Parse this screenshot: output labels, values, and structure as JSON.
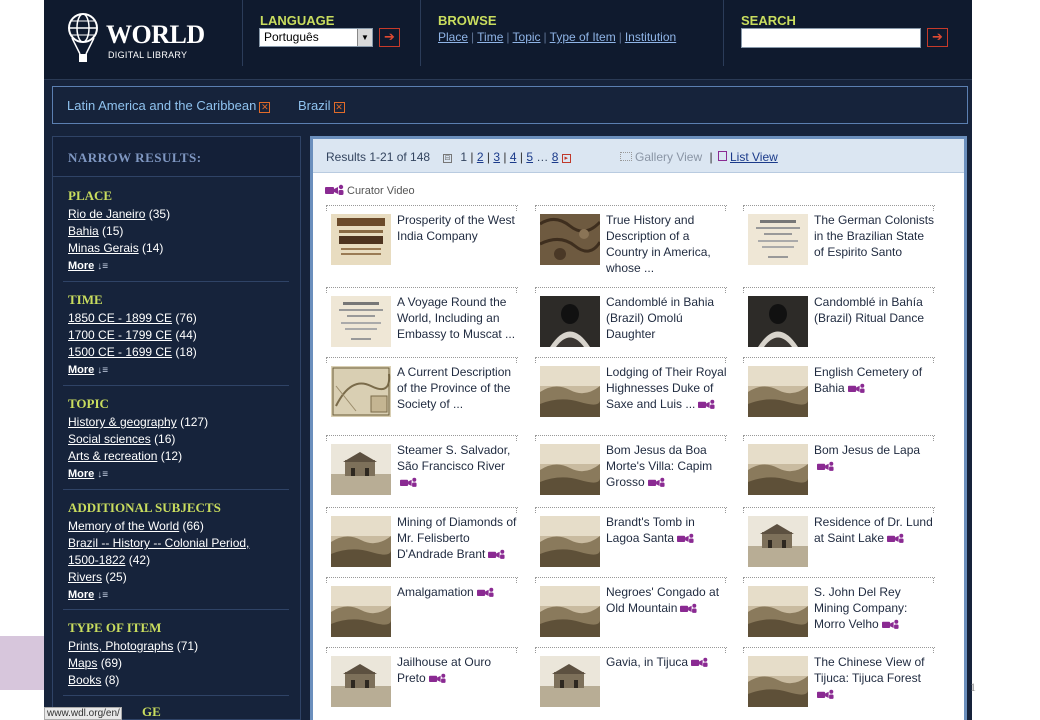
{
  "header": {
    "logo_word": "WORLD",
    "logo_sub": "DIGITAL LIBRARY",
    "language_label": "LANGUAGE",
    "language_value": "Português",
    "browse_label": "BROWSE",
    "browse_links": [
      "Place",
      "Time",
      "Topic",
      "Type of Item",
      "Institution"
    ],
    "search_label": "SEARCH",
    "go_glyph": "➔"
  },
  "filters": [
    "Latin America and the Caribbean",
    "Brazil"
  ],
  "filter_remove_glyph": "✕",
  "sidebar": {
    "heading": "NARROW RESULTS:",
    "more_label": "More",
    "sections": [
      {
        "title": "PLACE",
        "items": [
          {
            "label": "Rio de Janeiro",
            "count": "(35)"
          },
          {
            "label": "Bahia",
            "count": "(15)"
          },
          {
            "label": "Minas Gerais",
            "count": "(14)"
          }
        ]
      },
      {
        "title": "TIME",
        "items": [
          {
            "label": "1850 CE - 1899 CE",
            "count": "(76)"
          },
          {
            "label": "1700 CE - 1799 CE",
            "count": "(44)"
          },
          {
            "label": "1500 CE - 1699 CE",
            "count": "(18)"
          }
        ]
      },
      {
        "title": "TOPIC",
        "items": [
          {
            "label": "History & geography",
            "count": "(127)"
          },
          {
            "label": "Social sciences",
            "count": "(16)"
          },
          {
            "label": "Arts & recreation",
            "count": "(12)"
          }
        ]
      },
      {
        "title": "ADDITIONAL SUBJECTS",
        "items": [
          {
            "label": "Memory of the World",
            "count": "(66)"
          },
          {
            "label": "Brazil -- History -- Colonial Period,",
            "count": ""
          },
          {
            "label": "1500-1822",
            "count": "(42)"
          },
          {
            "label": "Rivers",
            "count": "(25)"
          }
        ]
      },
      {
        "title": "TYPE OF ITEM",
        "items": [
          {
            "label": "Prints, Photographs",
            "count": "(71)"
          },
          {
            "label": "Maps",
            "count": "(69)"
          },
          {
            "label": "Books",
            "count": "(8)"
          }
        ]
      }
    ],
    "cut_heading": "GE"
  },
  "results": {
    "summary": "Results 1-21 of 148",
    "pages": [
      "1",
      "2",
      "3",
      "4",
      "5",
      "…",
      "8"
    ],
    "gallery_view": "Gallery View",
    "list_view": "List View",
    "curator_video": "Curator Video",
    "items": [
      {
        "title": "Prosperity of the West India Company",
        "video": false,
        "thumb": "book"
      },
      {
        "title": "True History and Description of a Country in America, whose ...",
        "video": false,
        "thumb": "leather"
      },
      {
        "title": "The German Colonists in the Brazilian State of Espirito Santo",
        "video": false,
        "thumb": "page"
      },
      {
        "title": "A Voyage Round the World, Including an Embassy to Muscat ...",
        "video": false,
        "thumb": "page"
      },
      {
        "title": "Candomblé in Bahia (Brazil) Omolú Daughter",
        "video": false,
        "thumb": "dark"
      },
      {
        "title": "Candomblé in Bahía (Brazil) Ritual Dance",
        "video": false,
        "thumb": "dark"
      },
      {
        "title": "A Current Description of the Province of the Society of ...",
        "video": false,
        "thumb": "map"
      },
      {
        "title": "Lodging of Their Royal Highnesses Duke of Saxe and Luis ...",
        "video": true,
        "thumb": "sepia"
      },
      {
        "title": "English Cemetery of Bahia",
        "video": true,
        "thumb": "sepia"
      },
      {
        "title": "Steamer S. Salvador, São Francisco River",
        "video": true,
        "thumb": "light"
      },
      {
        "title": "Bom Jesus da Boa Morte's Villa: Capim Grosso",
        "video": true,
        "thumb": "sepia"
      },
      {
        "title": "Bom Jesus de Lapa",
        "video": true,
        "thumb": "sepia"
      },
      {
        "title": "Mining of Diamonds of Mr. Felisberto D'Andrade Brant",
        "video": true,
        "thumb": "sepia"
      },
      {
        "title": "Brandt's Tomb in Lagoa Santa",
        "video": true,
        "thumb": "sepia"
      },
      {
        "title": "Residence of Dr. Lund at Saint Lake",
        "video": true,
        "thumb": "light"
      },
      {
        "title": "Amalgamation",
        "video": true,
        "thumb": "sepia"
      },
      {
        "title": "Negroes' Congado at Old Mountain",
        "video": true,
        "thumb": "sepia"
      },
      {
        "title": "S. John Del Rey Mining Company: Morro Velho",
        "video": true,
        "thumb": "sepia"
      },
      {
        "title": "Jailhouse at Ouro Preto",
        "video": true,
        "thumb": "light"
      },
      {
        "title": "Gavia, in Tijuca",
        "video": true,
        "thumb": "light"
      },
      {
        "title": "The Chinese View of Tijuca: Tijuca Forest",
        "video": true,
        "thumb": "sepia"
      }
    ]
  },
  "status_url": "www.wdl.org/en/",
  "slide_number": "1",
  "colors": {
    "navy": "#16233b",
    "accent_green": "#c9dd5e",
    "link_blue": "#8fc2ee",
    "video_purple": "#8a2a92"
  }
}
